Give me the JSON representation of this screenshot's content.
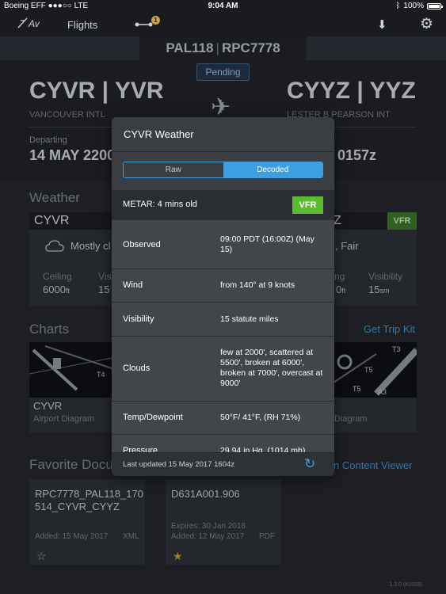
{
  "status_bar": {
    "carrier": "Boeing EFF",
    "signal": "●●●○○",
    "network": "LTE",
    "time": "9:04 AM",
    "battery": "100%"
  },
  "nav": {
    "logo": "Av",
    "flights_tab": "Flights",
    "route_badge": "1"
  },
  "flight": {
    "number": "PAL118",
    "callsign": "RPC7778",
    "status": "Pending"
  },
  "origin": {
    "code": "CYVR | YVR",
    "name": "VANCOUVER INTL"
  },
  "destination": {
    "code": "CYYZ | YYZ",
    "name": "LESTER B PEARSON INT"
  },
  "departing": {
    "label": "Departing",
    "value": "14 MAY 2200"
  },
  "arriving": {
    "value": "0157z"
  },
  "weather_section": {
    "title": "Weather",
    "left": {
      "station": "CYVR",
      "flight_rules": "VFR",
      "desc": "Mostly cl",
      "ceiling_label": "Ceiling",
      "ceiling_val": "6000",
      "ceiling_unit": "ft",
      "vis_label": "Vis",
      "vis_val": "15"
    },
    "right": {
      "station": "Z",
      "flight_rules": "VFR",
      "desc": "Fair",
      "ceiling_label": "ng",
      "ceiling_val": "0",
      "ceiling_unit": "ft",
      "vis_label": "Visibility",
      "vis_val": "15",
      "vis_unit": "sm"
    }
  },
  "charts_section": {
    "title": "Charts",
    "link": "Get Trip Kit",
    "left": {
      "title": "CYVR",
      "sub": "Airport Diagram"
    },
    "right": {
      "sub": "Diagram"
    }
  },
  "docs_section": {
    "title": "Favorite Docu",
    "link": "n Content Viewer",
    "doc1": {
      "name_line1": "RPC7778_PAL118_170",
      "name_line2": "514_CYVR_CYYZ",
      "added": "Added: 15 May 2017",
      "type": "XML",
      "star": "☆"
    },
    "doc2": {
      "name": "D631A001.906",
      "expires": "Expires: 30 Jan 2018",
      "added": "Added: 12 May 2017",
      "type": "PDF",
      "star": "★"
    }
  },
  "version": "1.3.0 (#1693)",
  "popover": {
    "title": "CYVR Weather",
    "segments": [
      {
        "label": "Raw",
        "active": false
      },
      {
        "label": "Decoded",
        "active": true
      }
    ],
    "metar_label": "METAR: 4 mins old",
    "flight_rules": "VFR",
    "rows": [
      {
        "label": "Observed",
        "value": "09:00 PDT (16:00Z) (May 15)"
      },
      {
        "label": "Wind",
        "value": "from 140° at 9 knots"
      },
      {
        "label": "Visibility",
        "value": "15 statute miles"
      },
      {
        "label": "Clouds",
        "value": "few at 2000', scattered at 5500', broken at 6000', broken at 7000', overcast at 9000'"
      },
      {
        "label": "Temp/Dewpoint",
        "value": "50°F/ 41°F, (RH 71%)"
      },
      {
        "label": "Pressure",
        "value": "29.94 in Hg, (1014 mb)"
      }
    ],
    "updated": "Last updated 15 May 2017 1604z"
  },
  "colors": {
    "accent": "#3d9fe0",
    "vfr": "#5cbb33",
    "badge": "#c8a24a"
  },
  "icons": [
    "av-logo-icon",
    "route-icon",
    "download-icon",
    "gear-icon",
    "plane-icon",
    "cloud-icon",
    "refresh-icon",
    "star-icon"
  ]
}
